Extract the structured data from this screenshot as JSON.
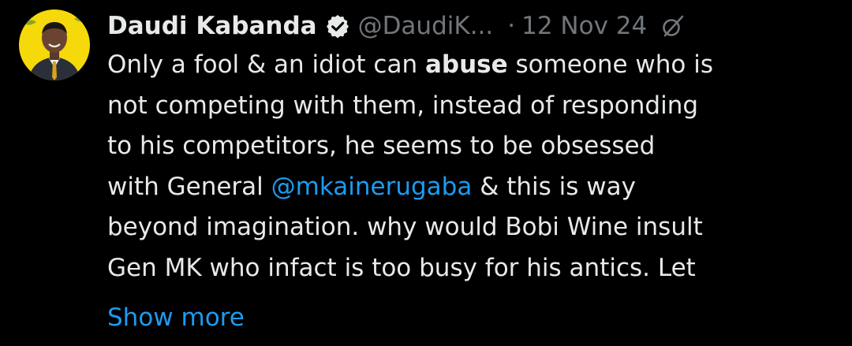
{
  "author": {
    "name": "Daudi Kabanda",
    "handle": "@DaudiK...",
    "separator": "·",
    "date": "12 Nov 24",
    "verified": true,
    "avatar_icon": "profile-photo",
    "verified_icon": "verified-badge-icon",
    "grok_icon": "grok-icon"
  },
  "tweet": {
    "lines": [
      {
        "pre": "Only a fool & an idiot can ",
        "bold": "abuse",
        "post": " someone who is"
      },
      {
        "text": "not competing with them, instead of responding"
      },
      {
        "text": "to his competitors, he seems to be obsessed"
      },
      {
        "pre": "with General ",
        "mention": "@mkainerugaba",
        "post": " & this is way"
      },
      {
        "text": "beyond imagination. why would Bobi Wine insult"
      },
      {
        "text": "Gen MK who infact is too busy for his antics. Let"
      }
    ],
    "show_more": "Show more"
  },
  "colors": {
    "background": "#000000",
    "text": "#e7e9ea",
    "muted": "#71767b",
    "accent": "#1d9bf0",
    "avatar_bg": "#f5d90a"
  }
}
